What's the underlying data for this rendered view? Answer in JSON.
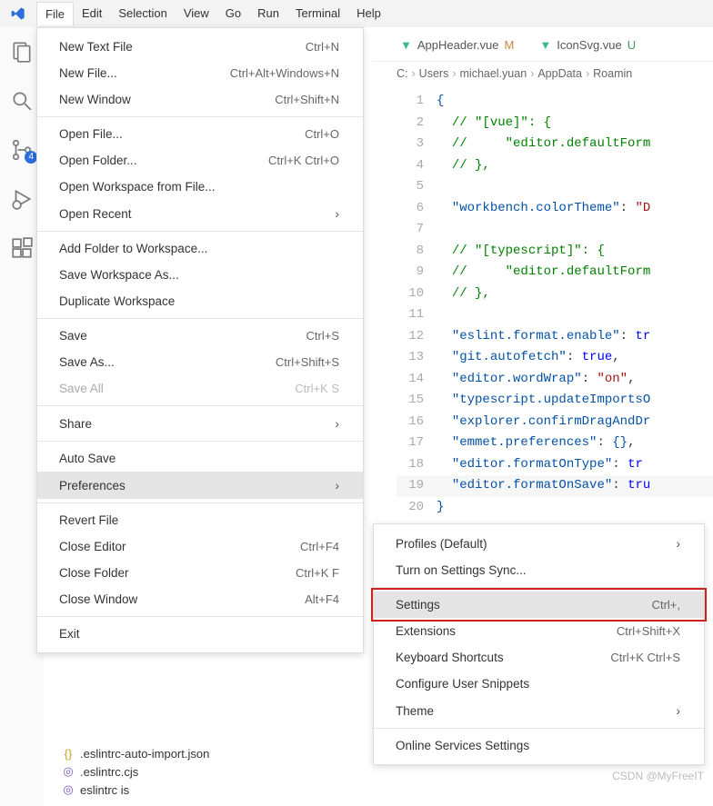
{
  "menubar": {
    "items": [
      "File",
      "Edit",
      "Selection",
      "View",
      "Go",
      "Run",
      "Terminal",
      "Help"
    ],
    "active": "File"
  },
  "activity_bar": {
    "icons": [
      "explorer-icon",
      "search-icon",
      "source-control-icon",
      "run-debug-icon",
      "extensions-icon"
    ],
    "source_control_badge": "4"
  },
  "file_menu": {
    "groups": [
      [
        {
          "label": "New Text File",
          "shortcut": "Ctrl+N"
        },
        {
          "label": "New File...",
          "shortcut": "Ctrl+Alt+Windows+N"
        },
        {
          "label": "New Window",
          "shortcut": "Ctrl+Shift+N"
        }
      ],
      [
        {
          "label": "Open File...",
          "shortcut": "Ctrl+O"
        },
        {
          "label": "Open Folder...",
          "shortcut": "Ctrl+K Ctrl+O"
        },
        {
          "label": "Open Workspace from File..."
        },
        {
          "label": "Open Recent",
          "submenu": true
        }
      ],
      [
        {
          "label": "Add Folder to Workspace..."
        },
        {
          "label": "Save Workspace As..."
        },
        {
          "label": "Duplicate Workspace"
        }
      ],
      [
        {
          "label": "Save",
          "shortcut": "Ctrl+S"
        },
        {
          "label": "Save As...",
          "shortcut": "Ctrl+Shift+S"
        },
        {
          "label": "Save All",
          "shortcut": "Ctrl+K S",
          "disabled": true
        }
      ],
      [
        {
          "label": "Share",
          "submenu": true
        }
      ],
      [
        {
          "label": "Auto Save"
        },
        {
          "label": "Preferences",
          "submenu": true,
          "hovered": true
        }
      ],
      [
        {
          "label": "Revert File"
        },
        {
          "label": "Close Editor",
          "shortcut": "Ctrl+F4"
        },
        {
          "label": "Close Folder",
          "shortcut": "Ctrl+K F"
        },
        {
          "label": "Close Window",
          "shortcut": "Alt+F4"
        }
      ],
      [
        {
          "label": "Exit"
        }
      ]
    ]
  },
  "pref_menu": {
    "groups": [
      [
        {
          "label": "Profiles (Default)",
          "submenu": true
        },
        {
          "label": "Turn on Settings Sync..."
        }
      ],
      [
        {
          "label": "Settings",
          "shortcut": "Ctrl+,",
          "hovered": true,
          "highlighted": true
        },
        {
          "label": "Extensions",
          "shortcut": "Ctrl+Shift+X"
        },
        {
          "label": "Keyboard Shortcuts",
          "shortcut": "Ctrl+K Ctrl+S"
        },
        {
          "label": "Configure User Snippets"
        },
        {
          "label": "Theme",
          "submenu": true
        }
      ],
      [
        {
          "label": "Online Services Settings"
        }
      ]
    ]
  },
  "tabs": [
    {
      "icon": "vue-icon",
      "name": "AppHeader.vue",
      "status": "M"
    },
    {
      "icon": "vue-icon",
      "name": "IconSvg.vue",
      "status": "U"
    }
  ],
  "breadcrumb": [
    "C:",
    "Users",
    "michael.yuan",
    "AppData",
    "Roamin"
  ],
  "editor_lines": [
    {
      "n": 1,
      "html": "<span class='brace'>{</span>"
    },
    {
      "n": 2,
      "html": "  <span class='com'>// \"[vue]\": {</span>"
    },
    {
      "n": 3,
      "html": "  <span class='com'>//     \"editor.defaultForm</span>"
    },
    {
      "n": 4,
      "html": "  <span class='com'>// },</span>"
    },
    {
      "n": 5,
      "html": ""
    },
    {
      "n": 6,
      "html": "  <span class='key'>\"workbench.colorTheme\"</span><span class='punct'>:</span> <span class='str'>\"D</span>"
    },
    {
      "n": 7,
      "html": ""
    },
    {
      "n": 8,
      "html": "  <span class='com'>// \"[typescript]\": {</span>"
    },
    {
      "n": 9,
      "html": "  <span class='com'>//     \"editor.defaultForm</span>"
    },
    {
      "n": 10,
      "html": "  <span class='com'>// },</span>"
    },
    {
      "n": 11,
      "html": ""
    },
    {
      "n": 12,
      "html": "  <span class='key'>\"eslint.format.enable\"</span><span class='punct'>:</span> <span class='bool'>tr</span>"
    },
    {
      "n": 13,
      "html": "  <span class='key'>\"git.autofetch\"</span><span class='punct'>:</span> <span class='bool'>true</span><span class='punct'>,</span>"
    },
    {
      "n": 14,
      "html": "  <span class='key'>\"editor.wordWrap\"</span><span class='punct'>:</span> <span class='str'>\"on\"</span><span class='punct'>,</span>"
    },
    {
      "n": 15,
      "html": "  <span class='key'>\"typescript.updateImportsO</span>"
    },
    {
      "n": 16,
      "html": "  <span class='key'>\"explorer.confirmDragAndDr</span>"
    },
    {
      "n": 17,
      "html": "  <span class='key'>\"emmet.preferences\"</span><span class='punct'>:</span> <span class='brace'>{}</span><span class='punct'>,</span>"
    },
    {
      "n": 18,
      "html": "  <span class='key'>\"editor.formatOnType\"</span><span class='punct'>:</span> <span class='bool'>tr</span>"
    },
    {
      "n": 19,
      "html": "  <span class='key'>\"editor.formatOnSave\"</span><span class='punct'>:</span> <span class='bool'>tru</span>",
      "hl": true
    },
    {
      "n": 20,
      "html": "<span class='brace'>}</span>"
    }
  ],
  "explorer": {
    "items": [
      {
        "icon": "{}",
        "cls": "yellow",
        "name": ".eslintrc-auto-import.json"
      },
      {
        "icon": "◎",
        "cls": "purple",
        "name": ".eslintrc.cjs"
      },
      {
        "icon": "◎",
        "cls": "purple",
        "name": "eslintrc is"
      }
    ]
  },
  "watermark": "CSDN @MyFreeIT"
}
